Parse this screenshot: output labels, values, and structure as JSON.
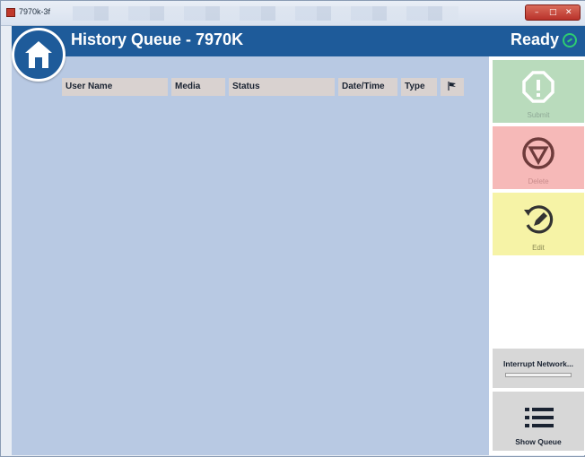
{
  "window": {
    "title": "7970k-3f"
  },
  "header": {
    "title": "History Queue - 7970K",
    "status": "Ready"
  },
  "table": {
    "columns": [
      "User Name",
      "Media",
      "Status",
      "Date/Time",
      "Type"
    ],
    "rows": []
  },
  "actions": {
    "submit_label": "Submit",
    "delete_label": "Delete",
    "edit_label": "Edit",
    "interrupt_label": "Interrupt Network...",
    "show_queue_label": "Show Queue"
  },
  "colors": {
    "header_blue": "#1e5b9a",
    "submit_bg": "#b9dbbc",
    "delete_bg": "#f6b9b8",
    "edit_bg": "#f6f3a6",
    "ready_green": "#2ecc71"
  }
}
